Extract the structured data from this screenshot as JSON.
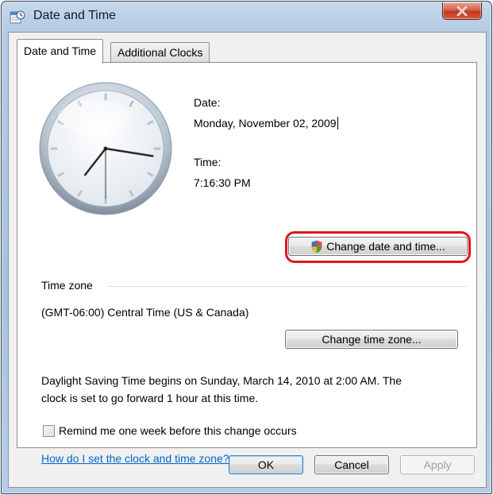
{
  "window": {
    "title": "Date and Time"
  },
  "tabs": [
    {
      "label": "Date and Time"
    },
    {
      "label": "Additional Clocks"
    }
  ],
  "datetime": {
    "date_label": "Date:",
    "date_value": "Monday, November 02, 2009",
    "time_label": "Time:",
    "time_value": "7:16:30 PM",
    "change_button": "Change date and time..."
  },
  "timezone": {
    "section_label": "Time zone",
    "value": "(GMT-06:00) Central Time (US & Canada)",
    "change_button": "Change time zone..."
  },
  "dst": {
    "line1": "Daylight Saving Time begins on Sunday, March 14, 2010 at 2:00 AM. The",
    "line2": "clock is set to go forward 1 hour at this time."
  },
  "reminder": {
    "label": "Remind me one week before this change occurs",
    "checked": false
  },
  "help_link": "How do I set the clock and time zone?",
  "footer": {
    "ok": "OK",
    "cancel": "Cancel",
    "apply": "Apply"
  },
  "clock": {
    "hour": 7,
    "minute": 16,
    "second": 30
  },
  "colors": {
    "highlight": "#e0141b",
    "link": "#0066cc"
  },
  "icons": [
    "date-time-app-icon",
    "close-icon",
    "clock-face-icon",
    "uac-shield-icon"
  ]
}
